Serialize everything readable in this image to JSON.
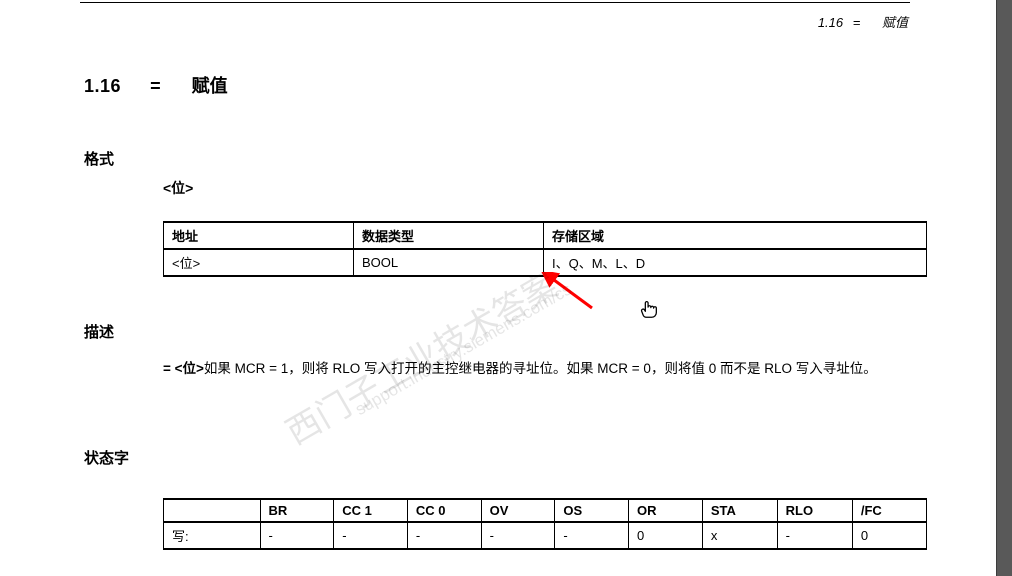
{
  "header": {
    "section": "1.16",
    "eq": "=",
    "title": "赋值"
  },
  "section_title": {
    "number": "1.16",
    "eq": "=",
    "text": "赋值"
  },
  "format": {
    "heading": "格式",
    "sub_bit": "<位>"
  },
  "table1": {
    "headers": [
      "地址",
      "数据类型",
      "存储区域"
    ],
    "row": [
      "<位>",
      "BOOL",
      "I、Q、M、L、D"
    ]
  },
  "desc": {
    "heading": "描述",
    "prefix_bold": "= <位>",
    "body": "如果 MCR = 1，则将 RLO 写入打开的主控继电器的寻址位。如果 MCR = 0，则将值 0 而不是 RLO 写入寻址位。"
  },
  "status": {
    "heading": "状态字",
    "headers": [
      "",
      "BR",
      "CC 1",
      "CC 0",
      "OV",
      "OS",
      "OR",
      "STA",
      "RLO",
      "/FC"
    ],
    "row": [
      "写:",
      "-",
      "-",
      "-",
      "-",
      "-",
      "0",
      "x",
      "-",
      "0"
    ]
  },
  "watermark": {
    "line1": "西门子工业技术答案",
    "line2": "support.industry.siemens.com/cs"
  }
}
